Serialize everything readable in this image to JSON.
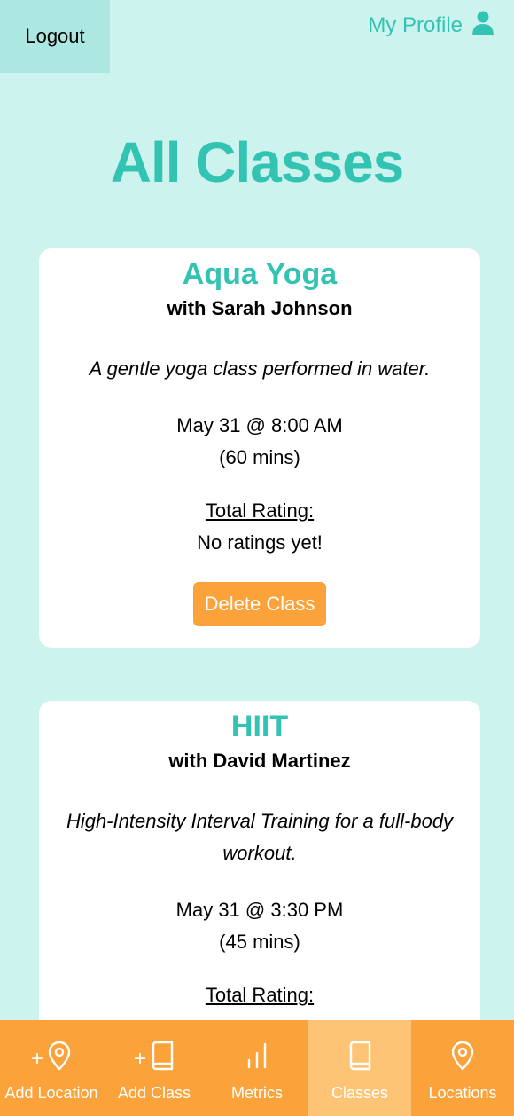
{
  "header": {
    "logout_label": "Logout",
    "profile_label": "My Profile"
  },
  "page": {
    "title": "All Classes"
  },
  "classes": [
    {
      "name": "Aqua Yoga",
      "instructor": "with Sarah Johnson",
      "description": "A gentle yoga class performed in water.",
      "datetime": "May 31 @ 8:00 AM",
      "duration": "(60 mins)",
      "rating_label": "Total Rating:",
      "rating_value": "No ratings yet!",
      "delete_label": "Delete Class"
    },
    {
      "name": "HIIT",
      "instructor": "with David Martinez",
      "description": "High-Intensity Interval Training for a full-body workout.",
      "datetime": "May 31 @ 3:30 PM",
      "duration": "(45 mins)",
      "rating_label": "Total Rating:"
    }
  ],
  "nav": {
    "items": [
      {
        "label": "Add Location",
        "icon": "add-location-icon"
      },
      {
        "label": "Add Class",
        "icon": "add-class-icon"
      },
      {
        "label": "Metrics",
        "icon": "metrics-icon"
      },
      {
        "label": "Classes",
        "icon": "book-icon",
        "active": true
      },
      {
        "label": "Locations",
        "icon": "location-pin-icon"
      }
    ]
  },
  "colors": {
    "background": "#cdf3ee",
    "accent": "#33c3b3",
    "nav": "#fba33a",
    "nav_active": "#fdc476",
    "logout_bg": "#ace8e1"
  }
}
